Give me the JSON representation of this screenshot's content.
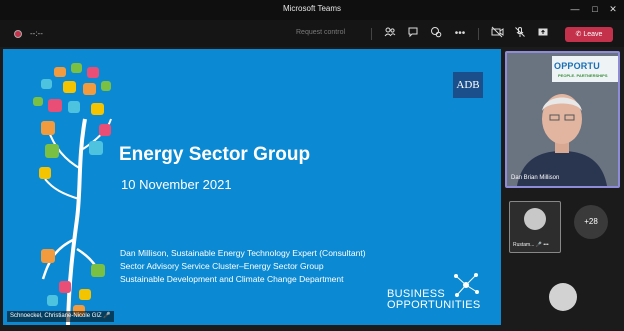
{
  "window": {
    "title": "Microsoft Teams"
  },
  "toolbar": {
    "timer": "--:--",
    "request_control": "Request control",
    "leave_label": "Leave"
  },
  "slide": {
    "logo_text": "ADB",
    "title": "Energy Sector Group",
    "date": "10 November 2021",
    "presenter_lines": [
      "Dan Millison, Sustainable Energy Technology Expert (Consultant)",
      "Sector Advisory Service Cluster–Energy Sector Group",
      "Sustainable Development and Climate Change Department"
    ],
    "business_line1": "BUSINESS",
    "business_line2": "OPPORTUNITIES",
    "caption": "Schnoeckel, Christiane-Nicole GIZ"
  },
  "participants": {
    "main_video_name": "Dan Brian Millison",
    "banner_title": "OPPORTU",
    "banner_sub": "PEOPLE. PARTNERSHIPS",
    "tile_name": "Rustam...",
    "more_count": "+28"
  },
  "colors": {
    "slide_bg": "#0b8ad3",
    "leave": "#c4314b",
    "active_border": "#8e8cd8"
  }
}
